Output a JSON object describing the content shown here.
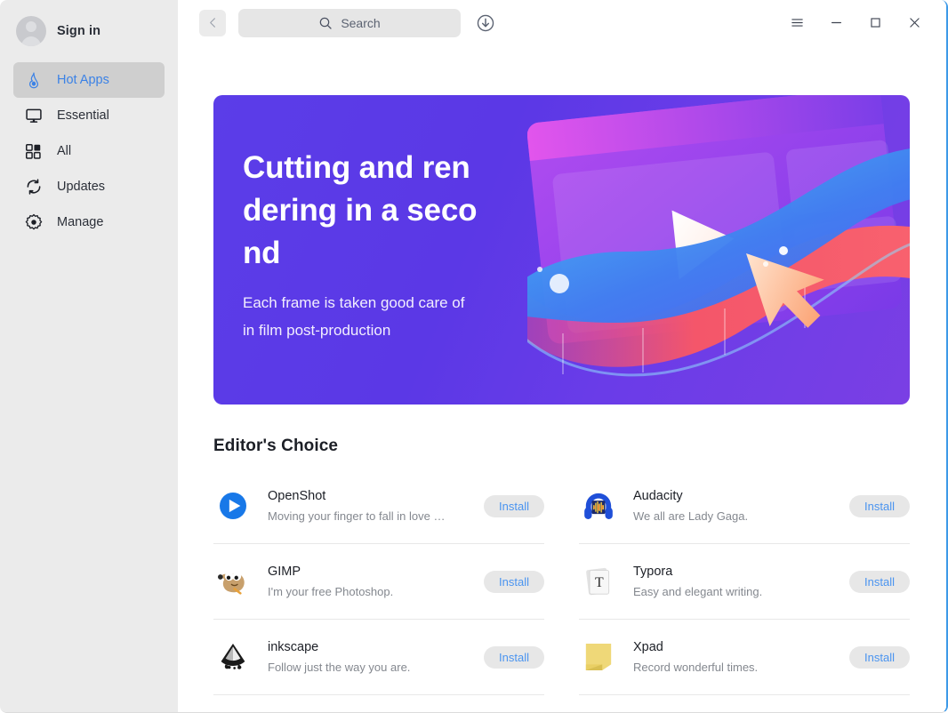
{
  "sidebar": {
    "account": {
      "label": "Sign in",
      "avatar_icon": "user-avatar-icon"
    },
    "items": [
      {
        "label": "Hot Apps",
        "icon": "flame-icon",
        "active": true
      },
      {
        "label": "Essential",
        "icon": "monitor-icon",
        "active": false
      },
      {
        "label": "All",
        "icon": "grid-icon",
        "active": false
      },
      {
        "label": "Updates",
        "icon": "refresh-icon",
        "active": false
      },
      {
        "label": "Manage",
        "icon": "gear-icon",
        "active": false
      }
    ]
  },
  "titlebar": {
    "back_icon": "chevron-left-icon",
    "search": {
      "placeholder": "Search",
      "icon": "search-icon",
      "value": ""
    },
    "download_icon": "download-circle-icon",
    "controls": [
      {
        "name": "menu",
        "icon": "hamburger-menu-icon"
      },
      {
        "name": "minimize",
        "icon": "minimize-icon"
      },
      {
        "name": "maximize",
        "icon": "maximize-icon"
      },
      {
        "name": "close",
        "icon": "close-icon"
      }
    ]
  },
  "banner": {
    "title": "Cutting and rendering in a second",
    "subtitle": "Each frame is taken good care of in film production",
    "subtitle_text": "Each frame is taken good care of in film post-production",
    "gradient_start": "#5b3de8",
    "gradient_end": "#7a3fe4",
    "art": "video-editing-illustration"
  },
  "main": {
    "section_title": "Editor's Choice",
    "install_label": "Install",
    "accent_color": "#4a94f0",
    "apps": [
      {
        "name": "OpenShot",
        "desc": "Moving your finger to fall in love with …",
        "icon": "openshot-icon",
        "action": "Install"
      },
      {
        "name": "Audacity",
        "desc": "We all are Lady Gaga.",
        "icon": "audacity-icon",
        "action": "Install"
      },
      {
        "name": "GIMP",
        "desc": "I'm your free Photoshop.",
        "icon": "gimp-icon",
        "action": "Install"
      },
      {
        "name": "Typora",
        "desc": "Easy and elegant writing.",
        "icon": "typora-icon",
        "action": "Install"
      },
      {
        "name": "inkscape",
        "desc": "Follow just the way you are.",
        "icon": "inkscape-icon",
        "action": "Install"
      },
      {
        "name": "Xpad",
        "desc": "Record wonderful times.",
        "icon": "xpad-icon",
        "action": "Install"
      }
    ]
  }
}
